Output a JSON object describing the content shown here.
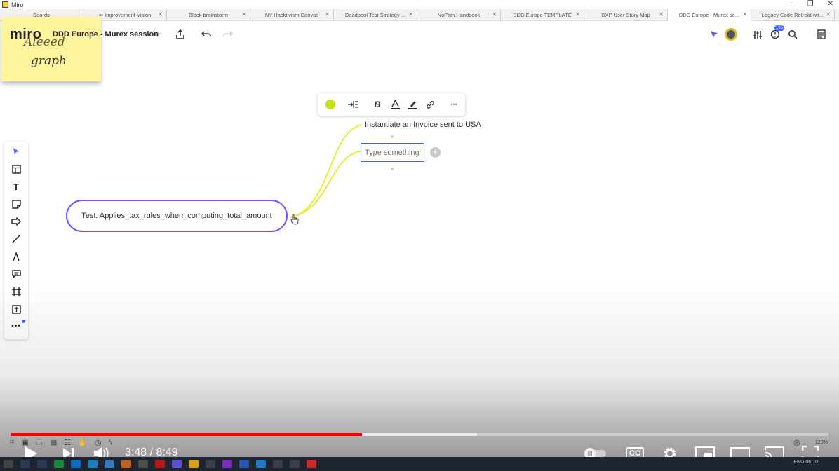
{
  "window": {
    "title": "Miro",
    "controls": [
      "–",
      "❐",
      "✕"
    ]
  },
  "tabs": [
    {
      "label": "Boards",
      "active": false
    },
    {
      "label": "⇹ Improvement Vision",
      "active": false
    },
    {
      "label": "Block brainstorm",
      "active": false
    },
    {
      "label": "NY Hacktivism Canvas",
      "active": false
    },
    {
      "label": "Deadpool Test Strategy ...",
      "active": false
    },
    {
      "label": "NoPain Handbook",
      "active": false
    },
    {
      "label": "DDD Europe TEMPLATE",
      "active": false
    },
    {
      "label": "DXP User Story Map",
      "active": false
    },
    {
      "label": "DDD Europe - Murex se...",
      "active": true
    },
    {
      "label": "Legacy Code Retreat wit...",
      "active": false
    }
  ],
  "topbar": {
    "logo": "miro",
    "board_title": "DDD Europe - Murex session",
    "notification_badge": "135"
  },
  "sticky_note": {
    "text": "graph",
    "partial_text": "Aleeed",
    "color": "#fff59d"
  },
  "left_toolbar": {
    "items": [
      {
        "name": "select-icon",
        "glyph": "➤"
      },
      {
        "name": "templates-icon",
        "glyph": "▤"
      },
      {
        "name": "text-icon",
        "glyph": "T"
      },
      {
        "name": "sticky-note-icon",
        "glyph": "◰"
      },
      {
        "name": "shape-icon",
        "glyph": "⇨"
      },
      {
        "name": "line-icon",
        "glyph": "╱"
      },
      {
        "name": "pen-icon",
        "glyph": "Å"
      },
      {
        "name": "comment-icon",
        "glyph": "▭"
      },
      {
        "name": "frame-icon",
        "glyph": "⌗"
      },
      {
        "name": "upload-icon",
        "glyph": "⇪"
      },
      {
        "name": "more-icon",
        "glyph": "•••"
      }
    ]
  },
  "format_toolbar": {
    "color": "#c6e021",
    "items": [
      "color-picker",
      "align",
      "bold",
      "text-color",
      "highlight",
      "link",
      "more"
    ]
  },
  "mindmap": {
    "root": "Test: Applies_tax_rules_when_computing_total_amount",
    "child": "Instantiate an Invoice sent to USA",
    "input_placeholder": "Type something",
    "branch_color": "#e8ec3a",
    "root_border": "#7c4dff"
  },
  "video": {
    "current_time": "3:48",
    "separator": "/",
    "duration": "8:49",
    "played_fraction": 0.43,
    "buffered_fraction": 0.57,
    "zoom": "120%"
  },
  "taskbar": {
    "tray_text": "ENG 06:10"
  }
}
